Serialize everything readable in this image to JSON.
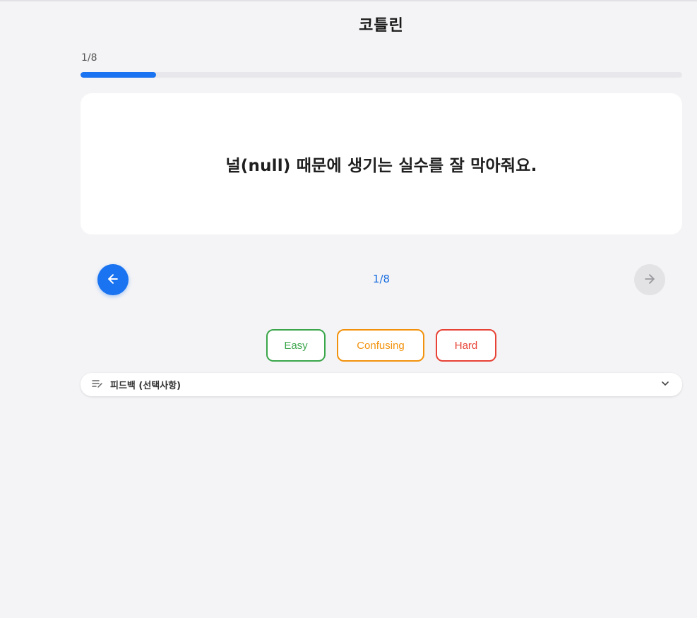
{
  "header": {
    "title": "코틀린"
  },
  "progress": {
    "text": "1/8",
    "fraction": 0.125,
    "accent": "#1a73f0"
  },
  "card": {
    "text": "널(null) 때문에 생기는 실수를 잘 막아줘요."
  },
  "navigation": {
    "prev_icon": "arrow-left-icon",
    "next_icon": "arrow-right-icon",
    "page_indicator": "1/8"
  },
  "difficulty": {
    "easy": {
      "label": "Easy",
      "color": "#3aa64a"
    },
    "confusing": {
      "label": "Confusing",
      "color": "#f2920c"
    },
    "hard": {
      "label": "Hard",
      "color": "#e84236"
    }
  },
  "feedback": {
    "icon": "edit-notes-icon",
    "label": "피드백 (선택사항)",
    "expand_icon": "chevron-down-icon"
  }
}
